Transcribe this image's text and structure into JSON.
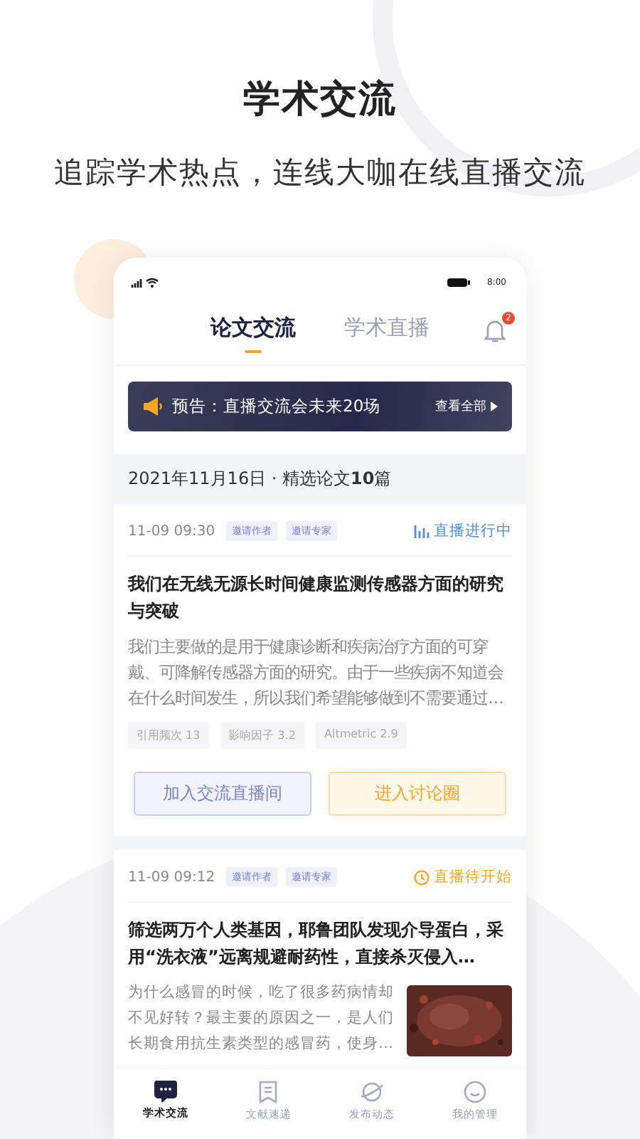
{
  "headline": "学术交流",
  "tagline": "追踪学术热点，连线大咖在线直播交流",
  "status_bar": {
    "time": "8:00"
  },
  "tabs": [
    {
      "label": "论文交流",
      "selected": true
    },
    {
      "label": "学术直播",
      "selected": false
    }
  ],
  "notification_badge": "2",
  "banner": {
    "text": "预告：直播交流会未来20场",
    "link": "查看全部"
  },
  "date_bar": "2021年11月16日 · 精选论文**10**篇",
  "papers": [
    {
      "time": "11-09 09:30",
      "tags": [
        "邀请作者",
        "邀请专家"
      ],
      "status": {
        "kind": "live",
        "text": "直播进行中"
      },
      "title": "我们在无线无源长时间健康监测传感器方面的研究与突破",
      "abstract": "我们主要做的是用于健康诊断和疾病治疗方面的可穿戴、可降解传感器方面的研究。由于一些疾病不知道会在什么时间发生，所以我们希望能够做到不需要通过…",
      "metrics": [
        "引用频次 13",
        "影响因子 3.2",
        "Altmetric 2.9"
      ],
      "actions": [
        "加入交流直播间",
        "进入讨论圈"
      ]
    },
    {
      "time": "11-09 09:12",
      "tags": [
        "邀请作者",
        "邀请专家"
      ],
      "status": {
        "kind": "upcoming",
        "text": "直播待开始"
      },
      "title": "筛选两万个人类基因，耶鲁团队发现介导蛋白，采用“洗衣液”远离规避耐药性，直接杀灭侵入…",
      "abstract": "为什么感冒的时候，吃了很多药病情却不见好转？最主要的原因之一，是人们长期食用抗生素类型的感冒药，使身…",
      "thumbnail": {
        "kind": "picture"
      }
    }
  ],
  "bottom_nav": [
    {
      "label": "学术交流",
      "selected": true,
      "kind": "chat"
    },
    {
      "label": "文献速递",
      "selected": false,
      "kind": "doc"
    },
    {
      "label": "发布动态",
      "selected": false,
      "kind": "planet"
    },
    {
      "label": "我的管理",
      "selected": false,
      "kind": "smile"
    }
  ]
}
